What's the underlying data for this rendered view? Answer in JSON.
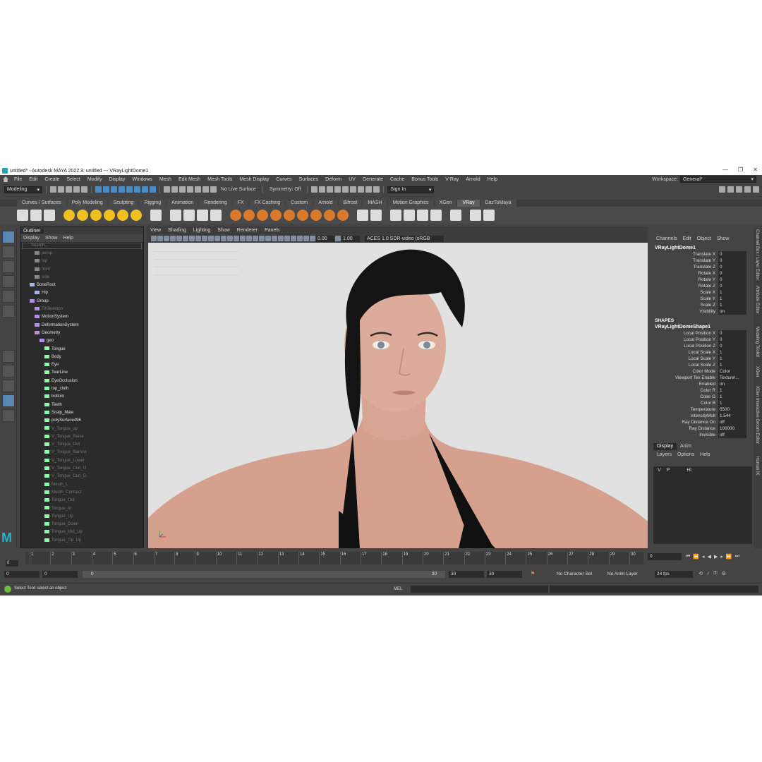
{
  "window": {
    "title": "untitled* - Autodesk MAYA 2022.3: untitled   ---   VRayLightDome1",
    "buttons": [
      "—",
      "❐",
      "✕"
    ]
  },
  "menubar": {
    "items": [
      "File",
      "Edit",
      "Create",
      "Select",
      "Modify",
      "Display",
      "Windows",
      "Mesh",
      "Edit Mesh",
      "Mesh Tools",
      "Mesh Display",
      "Curves",
      "Surfaces",
      "Deform",
      "UV",
      "Generate",
      "Cache",
      "Bonus Tools",
      "V-Ray",
      "Arnold",
      "Help"
    ],
    "workspace_label": "Workspace:",
    "workspace_value": "General*"
  },
  "statusline": {
    "mode": "Modeling",
    "live_surface": "No Live Surface",
    "symmetry": "Symmetry: Off",
    "signin": "Sign In"
  },
  "shelf": {
    "tabs": [
      "Curves / Surfaces",
      "Poly Modeling",
      "Sculpting",
      "Rigging",
      "Animation",
      "Rendering",
      "FX",
      "FX Caching",
      "Custom",
      "Arnold",
      "Bifrost",
      "MASH",
      "Motion Graphics",
      "XGen",
      "VRay",
      "DazToMaya"
    ],
    "active_tab": "VRay"
  },
  "outliner": {
    "tab": "Outliner",
    "menu": [
      "Display",
      "Show",
      "Help"
    ],
    "search_placeholder": "Search...",
    "items": [
      {
        "label": "persp",
        "indent": 2,
        "icon": "camera",
        "dim": true
      },
      {
        "label": "top",
        "indent": 2,
        "icon": "camera",
        "dim": true
      },
      {
        "label": "front",
        "indent": 2,
        "icon": "camera",
        "dim": true
      },
      {
        "label": "side",
        "indent": 2,
        "icon": "camera",
        "dim": true
      },
      {
        "label": "BoneRoot",
        "indent": 1,
        "icon": "joint",
        "dim": false
      },
      {
        "label": "Hip",
        "indent": 2,
        "icon": "joint",
        "dim": false
      },
      {
        "label": "Group",
        "indent": 1,
        "icon": "group",
        "dim": false
      },
      {
        "label": "FitSkeleton",
        "indent": 2,
        "icon": "group",
        "dim": true
      },
      {
        "label": "MotionSystem",
        "indent": 2,
        "icon": "group",
        "dim": false
      },
      {
        "label": "DeformationSystem",
        "indent": 2,
        "icon": "group",
        "dim": false
      },
      {
        "label": "Geometry",
        "indent": 2,
        "icon": "group",
        "dim": false
      },
      {
        "label": "geo",
        "indent": 3,
        "icon": "group",
        "dim": false
      },
      {
        "label": "Tongue",
        "indent": 4,
        "icon": "mesh",
        "dim": false
      },
      {
        "label": "Body",
        "indent": 4,
        "icon": "mesh",
        "dim": false
      },
      {
        "label": "Eye",
        "indent": 4,
        "icon": "mesh",
        "dim": false
      },
      {
        "label": "TearLine",
        "indent": 4,
        "icon": "mesh",
        "dim": false
      },
      {
        "label": "EyeOcclusion",
        "indent": 4,
        "icon": "mesh",
        "dim": false
      },
      {
        "label": "top_cloth",
        "indent": 4,
        "icon": "mesh",
        "dim": false
      },
      {
        "label": "bottom",
        "indent": 4,
        "icon": "mesh",
        "dim": false
      },
      {
        "label": "Teeth",
        "indent": 4,
        "icon": "mesh",
        "dim": false
      },
      {
        "label": "Scalp_Male",
        "indent": 4,
        "icon": "mesh",
        "dim": false
      },
      {
        "label": "polySurface496",
        "indent": 4,
        "icon": "mesh",
        "dim": false
      },
      {
        "label": "V_Tongue_up",
        "indent": 4,
        "icon": "mesh",
        "dim": true
      },
      {
        "label": "V_Tongue_Raise",
        "indent": 4,
        "icon": "mesh",
        "dim": true
      },
      {
        "label": "V_Tongue_Out",
        "indent": 4,
        "icon": "mesh",
        "dim": true
      },
      {
        "label": "V_Tongue_Narrow",
        "indent": 4,
        "icon": "mesh",
        "dim": true
      },
      {
        "label": "V_Tongue_Lower",
        "indent": 4,
        "icon": "mesh",
        "dim": true
      },
      {
        "label": "V_Tongue_Curl_U",
        "indent": 4,
        "icon": "mesh",
        "dim": true
      },
      {
        "label": "V_Tongue_Curl_D",
        "indent": 4,
        "icon": "mesh",
        "dim": true
      },
      {
        "label": "Mouth_L",
        "indent": 4,
        "icon": "mesh",
        "dim": true
      },
      {
        "label": "Mouth_Contract",
        "indent": 4,
        "icon": "mesh",
        "dim": true
      },
      {
        "label": "Tongue_Out",
        "indent": 4,
        "icon": "mesh",
        "dim": true
      },
      {
        "label": "Tongue_In",
        "indent": 4,
        "icon": "mesh",
        "dim": true
      },
      {
        "label": "Tongue_Up",
        "indent": 4,
        "icon": "mesh",
        "dim": true
      },
      {
        "label": "Tongue_Down",
        "indent": 4,
        "icon": "mesh",
        "dim": true
      },
      {
        "label": "Tongue_Mid_Up",
        "indent": 4,
        "icon": "mesh",
        "dim": true
      },
      {
        "label": "Tongue_Tip_Up",
        "indent": 4,
        "icon": "mesh",
        "dim": true
      }
    ]
  },
  "viewport": {
    "menu": [
      "View",
      "Shading",
      "Lighting",
      "Show",
      "Renderer",
      "Panels"
    ],
    "exposure": "0.00",
    "gamma": "1.00",
    "colorspace": "ACES 1.0 SDR-video (sRGB"
  },
  "channelbox": {
    "menu": [
      "Channels",
      "Edit",
      "Object",
      "Show"
    ],
    "object": "VRayLightDome1",
    "transform": [
      {
        "label": "Translate X",
        "value": "0"
      },
      {
        "label": "Translate Y",
        "value": "0"
      },
      {
        "label": "Translate Z",
        "value": "0"
      },
      {
        "label": "Rotate X",
        "value": "0"
      },
      {
        "label": "Rotate Y",
        "value": "0"
      },
      {
        "label": "Rotate Z",
        "value": "0"
      },
      {
        "label": "Scale X",
        "value": "1"
      },
      {
        "label": "Scale Y",
        "value": "1"
      },
      {
        "label": "Scale Z",
        "value": "1"
      },
      {
        "label": "Visibility",
        "value": "on"
      }
    ],
    "shapes_label": "SHAPES",
    "shape_name": "VRayLightDomeShape1",
    "shape_attrs": [
      {
        "label": "Local Position X",
        "value": "0"
      },
      {
        "label": "Local Position Y",
        "value": "0"
      },
      {
        "label": "Local Position Z",
        "value": "0"
      },
      {
        "label": "Local Scale X",
        "value": "1"
      },
      {
        "label": "Local Scale Y",
        "value": "1"
      },
      {
        "label": "Local Scale Z",
        "value": "1"
      },
      {
        "label": "Color Mode",
        "value": "Color"
      },
      {
        "label": "Viewport Tex Enable",
        "value": "Texture!..."
      },
      {
        "label": "Enabled",
        "value": "on"
      },
      {
        "label": "Color R",
        "value": "1"
      },
      {
        "label": "Color G",
        "value": "1"
      },
      {
        "label": "Color B",
        "value": "1"
      },
      {
        "label": "Temperature",
        "value": "6500"
      },
      {
        "label": "intensityMult",
        "value": "1.544"
      },
      {
        "label": "Ray Distance On",
        "value": "off"
      },
      {
        "label": "Ray Distance",
        "value": "100000"
      },
      {
        "label": "Invisible",
        "value": "off"
      }
    ],
    "side_tabs": [
      "Channel Box / Layer Editor",
      "Attribute Editor",
      "Modeling Toolkit",
      "XGen",
      "XGen Interactive Groom Editor",
      "Human IK"
    ]
  },
  "layers": {
    "tabs": [
      "Display",
      "Anim"
    ],
    "active_tab": "Display",
    "menu": [
      "Layers",
      "Options",
      "Help"
    ],
    "row": {
      "v": "V",
      "p": "P",
      "name": "Hi"
    }
  },
  "timeline": {
    "current_frame": "0",
    "ticks": [
      "1",
      "2",
      "3",
      "4",
      "5",
      "6",
      "7",
      "8",
      "9",
      "10",
      "11",
      "12",
      "13",
      "14",
      "15",
      "16",
      "17",
      "18",
      "19",
      "20",
      "21",
      "22",
      "23",
      "24",
      "25",
      "26",
      "27",
      "28",
      "29",
      "30"
    ],
    "frame_field": "0"
  },
  "range": {
    "start": "0",
    "start2": "0",
    "slider_start": "0",
    "slider_end": "30",
    "end": "30",
    "end2": "30",
    "character_set": "No Character Set",
    "anim_layer": "No Anim Layer",
    "fps": "24 fps"
  },
  "commandline": {
    "help": "Select Tool: select an object",
    "lang": "MEL"
  }
}
